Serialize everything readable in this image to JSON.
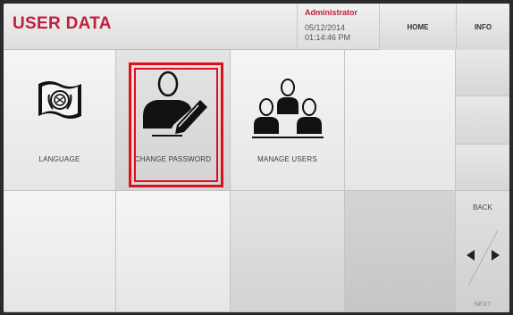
{
  "header": {
    "title": "USER DATA",
    "user_role": "Administrator",
    "date": "05/12/2014",
    "time": "01:14:46 PM",
    "home_label": "HOME",
    "info_label": "INFO"
  },
  "tiles": [
    {
      "label": "LANGUAGE",
      "icon": "un-flag-icon"
    },
    {
      "label": "CHANGE PASSWORD",
      "icon": "user-edit-icon"
    },
    {
      "label": "MANAGE USERS",
      "icon": "users-group-icon"
    }
  ],
  "nav": {
    "back_label": "BACK",
    "next_label": "NEXT"
  },
  "colors": {
    "accent": "#c1203c",
    "highlight": "#e0101a"
  }
}
